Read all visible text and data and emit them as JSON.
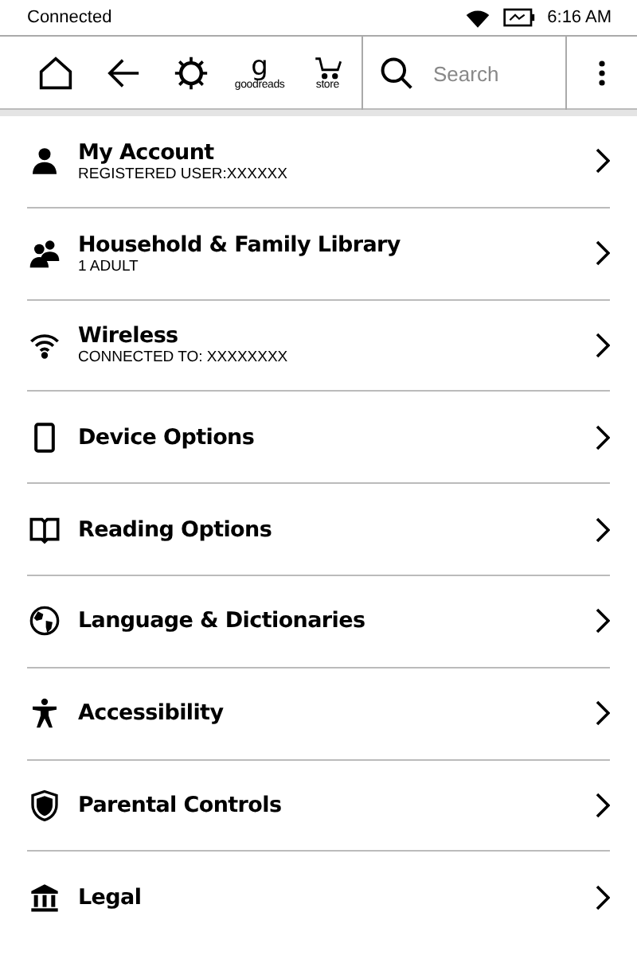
{
  "status_bar": {
    "connection": "Connected",
    "time": "6:16 AM"
  },
  "toolbar": {
    "goodreads": {
      "glyph": "g",
      "label": "goodreads"
    },
    "store": {
      "label": "store"
    },
    "search": {
      "placeholder": "Search"
    }
  },
  "settings": [
    {
      "title": "My Account",
      "subtitle": "REGISTERED USER:XXXXXX"
    },
    {
      "title": "Household & Family Library",
      "subtitle": "1 ADULT"
    },
    {
      "title": "Wireless",
      "subtitle": "CONNECTED TO: XXXXXXXX"
    },
    {
      "title": "Device Options"
    },
    {
      "title": "Reading Options"
    },
    {
      "title": "Language & Dictionaries"
    },
    {
      "title": "Accessibility"
    },
    {
      "title": "Parental Controls"
    },
    {
      "title": "Legal"
    }
  ]
}
